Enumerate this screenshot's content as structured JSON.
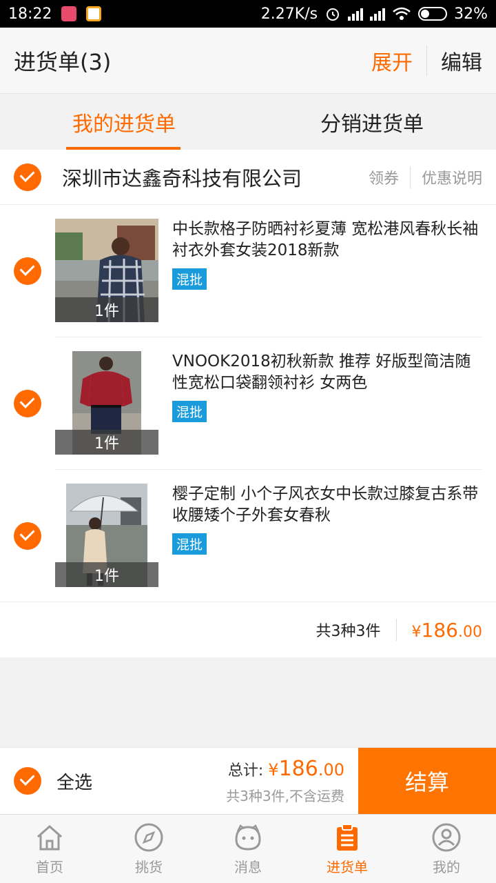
{
  "status": {
    "time": "18:22",
    "speed": "2.27K/s",
    "battery": "32%"
  },
  "header": {
    "title": "进货单(3)",
    "expand": "展开",
    "edit": "编辑"
  },
  "tabs": [
    {
      "label": "我的进货单",
      "active": true
    },
    {
      "label": "分销进货单",
      "active": false
    }
  ],
  "shop": {
    "name": "深圳市达鑫奇科技有限公司",
    "coupon": "领券",
    "promo": "优惠说明"
  },
  "items": [
    {
      "name": "中长款格子防晒衬衫夏薄 宽松港风春秋长袖衬衣外套女装2018新款",
      "tag": "混批",
      "qty": "1件"
    },
    {
      "name": "VNOOK2018初秋新款 推荐 好版型简洁随性宽松口袋翻领衬衫 女两色",
      "tag": "混批",
      "qty": "1件"
    },
    {
      "name": "樱子定制 小个子风衣女中长款过膝复古系带收腰矮个子外套女春秋",
      "tag": "混批",
      "qty": "1件"
    }
  ],
  "summary": {
    "count": "共3种3件",
    "currency": "¥",
    "price_int": "186",
    "price_dec": ".00"
  },
  "checkout": {
    "select_all": "全选",
    "total_label": "总计:",
    "currency": "¥",
    "price_int": "186",
    "price_dec": ".00",
    "note": "共3种3件,不含运费",
    "pay": "结算"
  },
  "nav": [
    {
      "label": "首页",
      "icon": "home-icon"
    },
    {
      "label": "挑货",
      "icon": "compass-icon"
    },
    {
      "label": "消息",
      "icon": "message-cat-icon"
    },
    {
      "label": "进货单",
      "icon": "clipboard-icon",
      "active": true
    },
    {
      "label": "我的",
      "icon": "user-icon"
    }
  ],
  "colors": {
    "accent": "#ff6a00",
    "tag": "#1a9bdc"
  }
}
